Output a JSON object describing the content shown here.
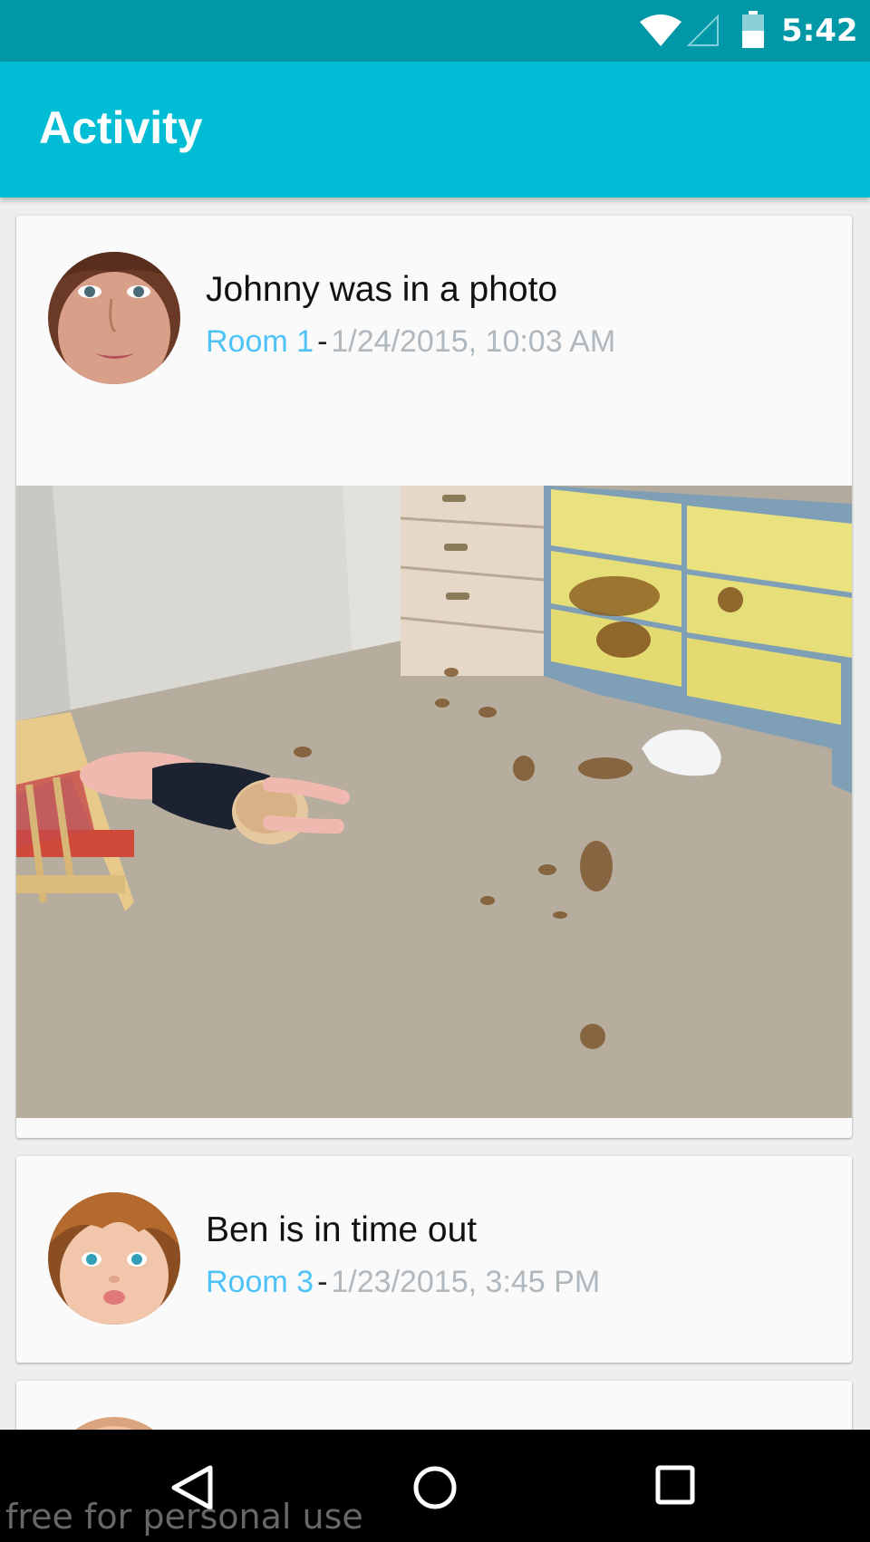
{
  "status_bar": {
    "time": "5:42",
    "icons": [
      "wifi-icon",
      "cell-signal-icon",
      "battery-icon"
    ]
  },
  "app_bar": {
    "title": "Activity",
    "color": "#00bcd4"
  },
  "colors": {
    "status_bar": "#0097a7",
    "room_link": "#4fc3f7",
    "timestamp": "#b0b8be"
  },
  "feed": [
    {
      "headline": "Johnny was in a photo",
      "room": "Room 1",
      "separator": "-",
      "timestamp": "1/24/2015, 10:03 AM",
      "has_photo": true
    },
    {
      "headline": "Ben is in time out",
      "room": "Room 3",
      "separator": "-",
      "timestamp": "1/23/2015, 3:45 PM",
      "has_photo": false
    }
  ],
  "nav_bar": {
    "icons": [
      "back-icon",
      "home-icon",
      "recents-icon"
    ]
  },
  "watermark": "free for personal use"
}
